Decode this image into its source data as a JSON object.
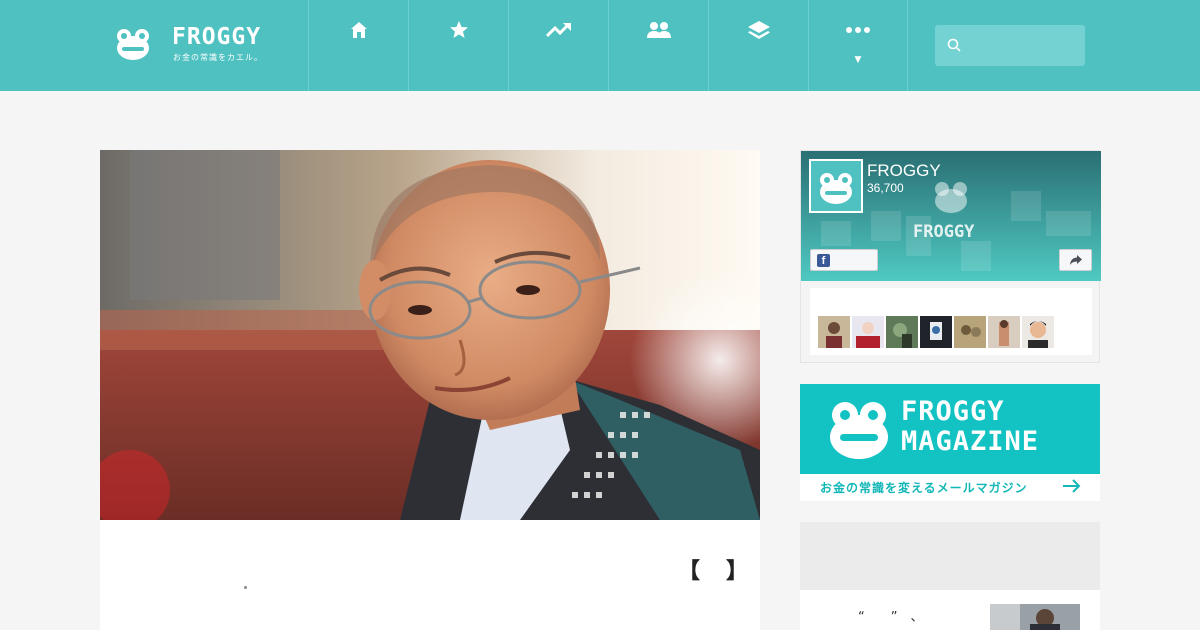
{
  "header": {
    "logo_text": "FROGGY",
    "logo_tagline": "お金の常識をカエル。",
    "nav": [
      {
        "icon": "home-icon"
      },
      {
        "icon": "star-icon"
      },
      {
        "icon": "trending-icon"
      },
      {
        "icon": "users-icon"
      },
      {
        "icon": "layers-icon"
      },
      {
        "icon": "more-icon",
        "caret": "▼"
      }
    ],
    "search_placeholder": ""
  },
  "article": {
    "bracket_open": "【",
    "bracket_close": "】"
  },
  "facebook": {
    "page_name": "FROGGY",
    "followers": "36,700",
    "like_icon": "f"
  },
  "magazine": {
    "title_line1": "FROGGY",
    "title_line2": "MAGAZINE",
    "subtitle": "お金の常識を変えるメールマガジン"
  },
  "card": {
    "text": "“　　”　、"
  },
  "colors": {
    "brand": "#4fc1c1",
    "magazine": "#13c2c2",
    "facebook": "#3b5998"
  }
}
